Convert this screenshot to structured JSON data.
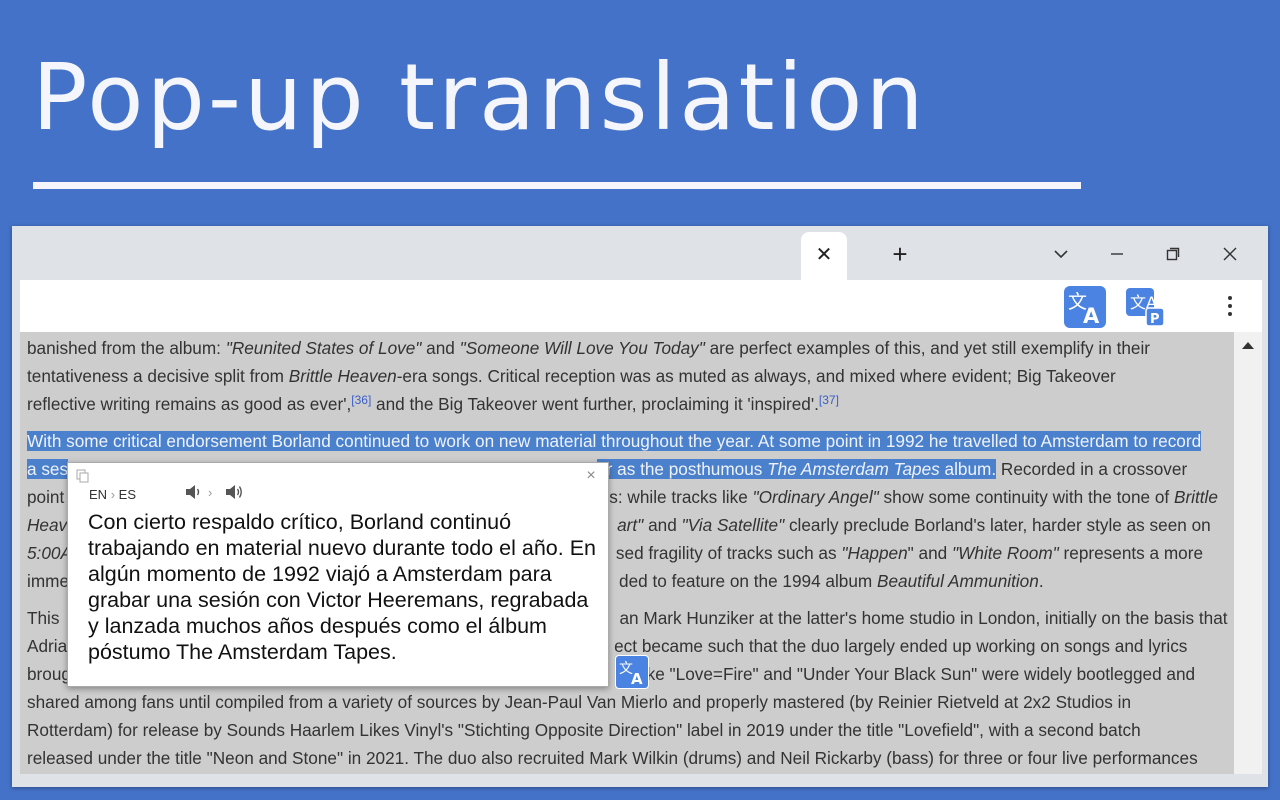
{
  "hero": {
    "title": "Pop-up translation"
  },
  "browser": {
    "tab_close_icon": "close-icon",
    "new_tab_icon": "plus-icon",
    "toolbar_icons": [
      "translate-extension-icon",
      "translate-page-extension-icon",
      "kebab-menu-icon"
    ]
  },
  "article": {
    "p1": {
      "l1a": "banished from the album: ",
      "l1b": "\"Reunited States of Love\"",
      "l1c": " and ",
      "l1d": "\"Someone Will Love You Today\"",
      "l1e": " are perfect examples of this, and yet still exemplify in their",
      "l2a": "tentativeness a decisive split from ",
      "l2b": "Brittle Heaven",
      "l2c": "-era songs. Critical reception was as muted as always, and mixed where evident; Big Takeover",
      "l3a": "reflective writing remains as good as ever',",
      "l3b": "[36]",
      "l3c": " and the Big Takeover went further, proclaiming it 'inspired'.",
      "l3d": "[37]"
    },
    "p2": {
      "l1": "With some critical endorsement Borland continued to work on new material throughout the year. At some point in 1992 he travelled to Amsterdam to record",
      "l2a": "a ses",
      "l2b": "er as the posthumous ",
      "l2c": "The Amsterdam Tapes",
      "l2d": " album.",
      "l2e": " Recorded in a crossover",
      "l3a": "point",
      "l3b": "s: while tracks like ",
      "l3c": "\"Ordinary Angel\"",
      "l3d": " show some continuity with the tone of ",
      "l3e": "Brittle",
      "l4a": "Heav",
      "l4b": "art\"",
      "l4c": " and ",
      "l4d": "\"Via Satellite\"",
      "l4e": " clearly preclude Borland's later, harder style as seen on",
      "l5a": "5:00A",
      "l5b": "sed fragility of tracks such as ",
      "l5c": "\"Happen",
      "l5d": "\" and ",
      "l5e": "\"White Room\"",
      "l5f": " represents a more",
      "l6a": "imme",
      "l6b": "ded to feature on the 1994 album ",
      "l6c": "Beautiful Ammunition",
      "l6d": "."
    },
    "p3": {
      "l1a": "This",
      "l1b": "an Mark Hunziker at the latter's home studio in London, initially on the basis that",
      "l2a": "Adria",
      "l2b": "ect became such that the duo largely ended up working on songs and lyrics",
      "l3a": "broug",
      "l3b": "like \"Love=Fire\" and \"Under Your Black Sun\" were widely bootlegged and",
      "l4": "shared among fans until compiled from a variety of sources by Jean-Paul Van Mierlo and properly mastered (by Reinier Rietveld at 2x2 Studios in",
      "l5": "Rotterdam) for release by Sounds Haarlem Likes Vinyl's \"Stichting Opposite Direction\" label in 2019 under the title \"Lovefield\", with a second batch",
      "l6": "released under the title \"Neon and Stone\" in 2021. The duo also recruited Mark Wilkin (drums) and Neil Rickarby (bass) for three or four live performances"
    }
  },
  "popup": {
    "source_lang": "EN",
    "target_lang": "ES",
    "lang_separator": "›",
    "voice_separator": "›",
    "translation": "Con cierto respaldo crítico, Borland continuó trabajando en material nuevo durante todo el año. En algún momento de 1992 viajó a Amsterdam para grabar una sesión con Victor Heeremans, regrabada y lanzada muchos años después como el álbum póstumo The Amsterdam Tapes.",
    "close_symbol": "×"
  },
  "colors": {
    "background": "#4472c8",
    "accent": "#4a83e1",
    "highlight": "#4b80cc"
  }
}
